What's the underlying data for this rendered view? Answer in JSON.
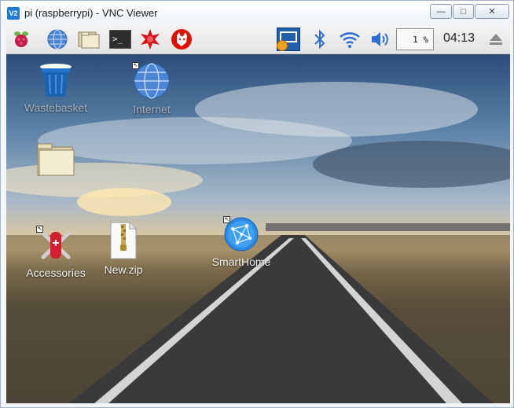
{
  "window": {
    "app_icon": "V2",
    "title": "pi (raspberrypi) - VNC Viewer",
    "min_glyph": "—",
    "max_glyph": "□",
    "close_glyph": "✕"
  },
  "taskbar": {
    "cpu": "1 %",
    "clock": "04:13",
    "terminal_glyph": ">_",
    "icons": [
      "raspberry-menu-icon",
      "web-browser-icon",
      "file-manager-icon",
      "terminal-icon",
      "mathematica-icon",
      "wolfram-icon",
      "vnc-server-icon",
      "bluetooth-icon",
      "wifi-icon",
      "volume-icon",
      "eject-icon"
    ]
  },
  "desktop": {
    "icons": [
      {
        "label": "Wastebasket"
      },
      {
        "label": "Internet"
      },
      {
        "label": ""
      },
      {
        "label": "Accessories"
      },
      {
        "label": "New.zip"
      },
      {
        "label": "SmartHome"
      }
    ]
  }
}
